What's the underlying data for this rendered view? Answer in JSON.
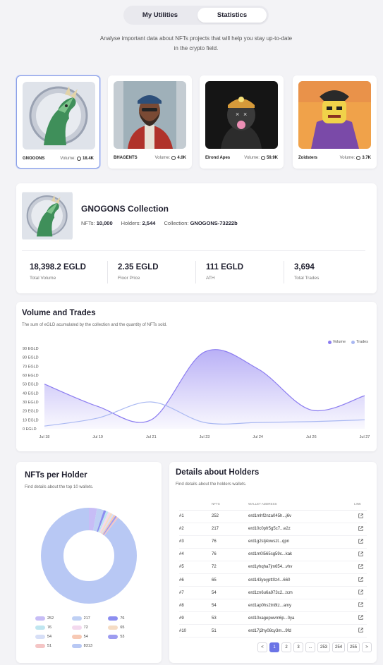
{
  "tabs": [
    {
      "label": "My Utilities"
    },
    {
      "label": "Statistics"
    }
  ],
  "intro": "Analyse important data about NFTs projects that will help you stay up-to-date in the crypto field.",
  "collections": [
    {
      "name": "GNOGONS",
      "volume_label": "Volume:",
      "volume": "18.4K",
      "selected": true
    },
    {
      "name": "BHAGENTS",
      "volume_label": "Volume:",
      "volume": "4.0K",
      "selected": false
    },
    {
      "name": "Elrond Apes",
      "volume_label": "Volume:",
      "volume": "59.9K",
      "selected": false
    },
    {
      "name": "Zoidsters",
      "volume_label": "Volume:",
      "volume": "3.7K",
      "selected": false
    }
  ],
  "summary": {
    "title": "GNOGONS Collection",
    "nfts_label": "NFTs:",
    "nfts": "10,000",
    "holders_label": "Holders:",
    "holders": "2,544",
    "collection_label": "Collection:",
    "collection": "GNOGONS-73222b",
    "stats": [
      {
        "value": "18,398.2 EGLD",
        "label": "Total Volume"
      },
      {
        "value": "2.35 EGLD",
        "label": "Floor Price"
      },
      {
        "value": "111 EGLD",
        "label": "ATH"
      },
      {
        "value": "3,694",
        "label": "Total Trades"
      }
    ]
  },
  "volume_chart": {
    "title": "Volume and Trades",
    "subtitle": "The sum of eGLD acumulated by the collection and the quantity of NFTs sold.",
    "legend": [
      "Volume",
      "Trades"
    ]
  },
  "chart_data": {
    "type": "line",
    "x": [
      "Jul 18",
      "Jul 19",
      "Jul 21",
      "Jul 23",
      "Jul 24",
      "Jul 26",
      "Jul 27"
    ],
    "y_ticks": [
      "90 EGLD",
      "80 EGLD",
      "70 EGLD",
      "60 EGLD",
      "50 EGLD",
      "40 EGLD",
      "30 EGLD",
      "20 EGLD",
      "10 EGLD",
      "0 EGLD"
    ],
    "ylim": [
      0,
      90
    ],
    "series": [
      {
        "name": "Volume",
        "values": [
          50,
          25,
          10,
          86,
          67,
          21,
          37
        ],
        "color": "#8b7cf0",
        "fill": true
      },
      {
        "name": "Trades",
        "values": [
          3,
          12,
          30,
          7,
          7,
          8,
          10
        ],
        "color": "#a9b8f2",
        "fill": false
      }
    ],
    "legend": "top-right",
    "grid": false
  },
  "nfts_per_holder": {
    "title": "NFTs per Holder",
    "subtitle": "Find details about the top 10 wallets.",
    "slices": [
      {
        "label": "252",
        "value": 252,
        "color": "#c7bdf6"
      },
      {
        "label": "217",
        "value": 217,
        "color": "#bfd0f4"
      },
      {
        "label": "76",
        "value": 76,
        "color": "#8c8ef0"
      },
      {
        "label": "76",
        "value": 76,
        "color": "#bfe6f0"
      },
      {
        "label": "72",
        "value": 72,
        "color": "#f3d9ee"
      },
      {
        "label": "65",
        "value": 65,
        "color": "#f5dcc4"
      },
      {
        "label": "54",
        "value": 54,
        "color": "#d7dff7"
      },
      {
        "label": "54",
        "value": 54,
        "color": "#f7c9b4"
      },
      {
        "label": "53",
        "value": 53,
        "color": "#9d9cf0"
      },
      {
        "label": "51",
        "value": 51,
        "color": "#f4c5c5"
      },
      {
        "label": "8313",
        "value": 8313,
        "color": "#b8c8f4"
      }
    ]
  },
  "holders_details": {
    "title": "Details about Holders",
    "subtitle": "Find details about the holders wallets.",
    "columns": [
      "",
      "NFTS",
      "WALLET ADDRESS",
      "LINK"
    ],
    "rows": [
      [
        "#1",
        "252",
        "erd1mhf2nza045h...j6v"
      ],
      [
        "#2",
        "217",
        "erd10c0pfr5g5c7...e2z"
      ],
      [
        "#3",
        "76",
        "erd1g2stj4xwszt...qpn"
      ],
      [
        "#4",
        "76",
        "erd1m0l565sg59c...kak"
      ],
      [
        "#5",
        "72",
        "erd1yhqha7jm654...vhv"
      ],
      [
        "#6",
        "65",
        "erd143yeyptt0z4...660"
      ],
      [
        "#7",
        "54",
        "erd1zn6u6a973c2...tcm"
      ],
      [
        "#8",
        "54",
        "erd1ap0hs2tn8tz...amy"
      ],
      [
        "#9",
        "53",
        "erd10xagepwvm6p...0ya"
      ],
      [
        "#10",
        "51",
        "erd17j2hy08cy3m...9fd"
      ]
    ],
    "pagination": [
      "<",
      "1",
      "2",
      "3",
      "...",
      "253",
      "254",
      "255",
      ">"
    ],
    "current_page": "1"
  },
  "colors": {
    "accent": "#6b74e6",
    "volume": "#8b7cf0",
    "trades": "#a9b8f2"
  }
}
